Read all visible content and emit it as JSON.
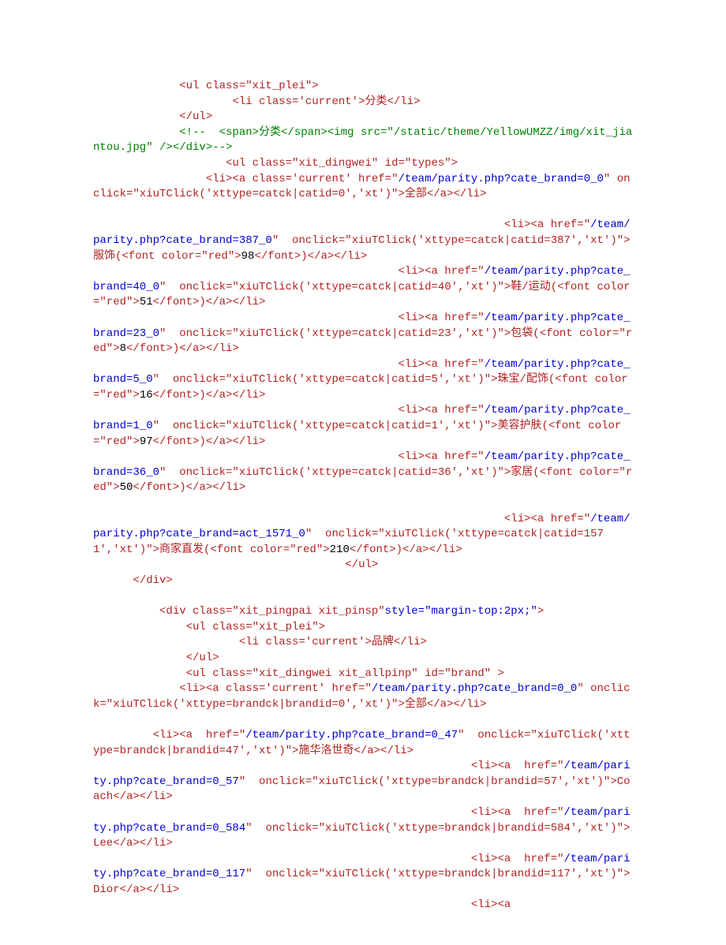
{
  "seg": {
    "s01": "             <ul class=\"xit_plei\">",
    "s02": "                     <li class='current'>分类</li>",
    "s03": "             </ul>",
    "s04a": "             <!--  <span>分类</span><img src=\"",
    "s04b": "/static/theme/YellowUMZZ/img/xit_jiantou.jpg",
    "s04c": "\" /></div>-->",
    "s05": "                    <ul class=\"xit_dingwei\" id=\"types\">",
    "s06a": "                 <li><a class='current' href=\"",
    "s06b": "/team/parity.php?cate_brand=0_0",
    "s06c": "\" onclick=\"xiuTClick('xttype=catck|catid=0','xt')\">全部</a></li>",
    "s07a": "                                                              <li><a href=\"",
    "s07b": "/team/parity.php?cate_brand=387_0",
    "s07c": "\"  onclick=\"xiuTClick('xttype=catck|catid=387','xt')\">服饰(<font color=\"red\">",
    "s07d": "98",
    "s07e": "</font>)</a></li>",
    "s08a": "                                              <li><a href=\"",
    "s08b": "/team/parity.php?cate_brand=40_0",
    "s08c": "\"  onclick=\"xiuTClick('xttype=catck|catid=40','xt')\">鞋/运动(<font color=\"red\">",
    "s08d": "51",
    "s08e": "</font>)</a></li>",
    "s09a": "                                              <li><a href=\"",
    "s09b": "/team/parity.php?cate_brand=23_0",
    "s09c": "\"  onclick=\"xiuTClick('xttype=catck|catid=23','xt')\">包袋(<font color=\"red\">",
    "s09d": "8",
    "s09e": "</font>)</a></li>",
    "s10a": "                                              <li><a href=\"",
    "s10b": "/team/parity.php?cate_brand=5_0",
    "s10c": "\"  onclick=\"xiuTClick('xttype=catck|catid=5','xt')\">珠宝/配饰(<font color=\"red\">",
    "s10d": "16",
    "s10e": "</font>)</a></li>",
    "s11a": "                                              <li><a href=\"",
    "s11b": "/team/parity.php?cate_brand=1_0",
    "s11c": "\"  onclick=\"xiuTClick('xttype=catck|catid=1','xt')\">美容护肤(<font color=\"red\">",
    "s11d": "97",
    "s11e": "</font>)</a></li>",
    "s12a": "                                              <li><a href=\"",
    "s12b": "/team/parity.php?cate_brand=36_0",
    "s12c": "\"  onclick=\"xiuTClick('xttype=catck|catid=36','xt')\">家居(<font color=\"red\">",
    "s12d": "50",
    "s12e": "</font>)</a></li>",
    "s13a": "                                                              <li><a href=\"",
    "s13b": "/team/parity.php?cate_brand=act_1571_0",
    "s13c": "\"  onclick=\"xiuTClick('xttype=catck|catid=1571','xt')\">商家直发(<font color=\"red\">",
    "s13d": "210",
    "s13e": "</font>)</a></li>",
    "s14": "                                      </ul>",
    "s15": "      </div>",
    "s16a": "          <div class=\"xit_pingpai xit_pinsp\"",
    "s16b": "style=\"margin-top:2px;\"",
    "s16c": ">",
    "s17": "              <ul class=\"xit_plei\">",
    "s18": "                      <li class='current'>品牌</li>",
    "s19": "              </ul>",
    "s20": "              <ul class=\"xit_dingwei xit_allpinp\" id=\"brand\" >",
    "s21a": "             <li><a class='current' href=\"",
    "s21b": "/team/parity.php?cate_brand=0_0",
    "s21c": "\" onclick=\"xiuTClick('xttype=brandck|brandid=0','xt')\">全部</a></li>",
    "s22a": "         <li><a  href=\"",
    "s22b": "/team/parity.php?cate_brand=0_47",
    "s22c": "\"  onclick=\"xiuTClick('xttype=brandck|brandid=47','xt')\">施华洛世奇</a></li>",
    "s23a": "                                                         <li><a  href=\"",
    "s23b": "/team/parity.php?cate_brand=0_57",
    "s23c": "\"  onclick=\"xiuTClick('xttype=brandck|brandid=57','xt')\">Coach</a></li>",
    "s24a": "                                                         <li><a  href=\"",
    "s24b": "/team/parity.php?cate_brand=0_584",
    "s24c": "\"  onclick=\"xiuTClick('xttype=brandck|brandid=584','xt')\">Lee</a></li>",
    "s25a": "                                                         <li><a  href=\"",
    "s25b": "/team/parity.php?cate_brand=0_117",
    "s25c": "\"  onclick=\"xiuTClick('xttype=brandck|brandid=117','xt')\">Dior</a></li>",
    "s26": "                                                         <li><a"
  }
}
